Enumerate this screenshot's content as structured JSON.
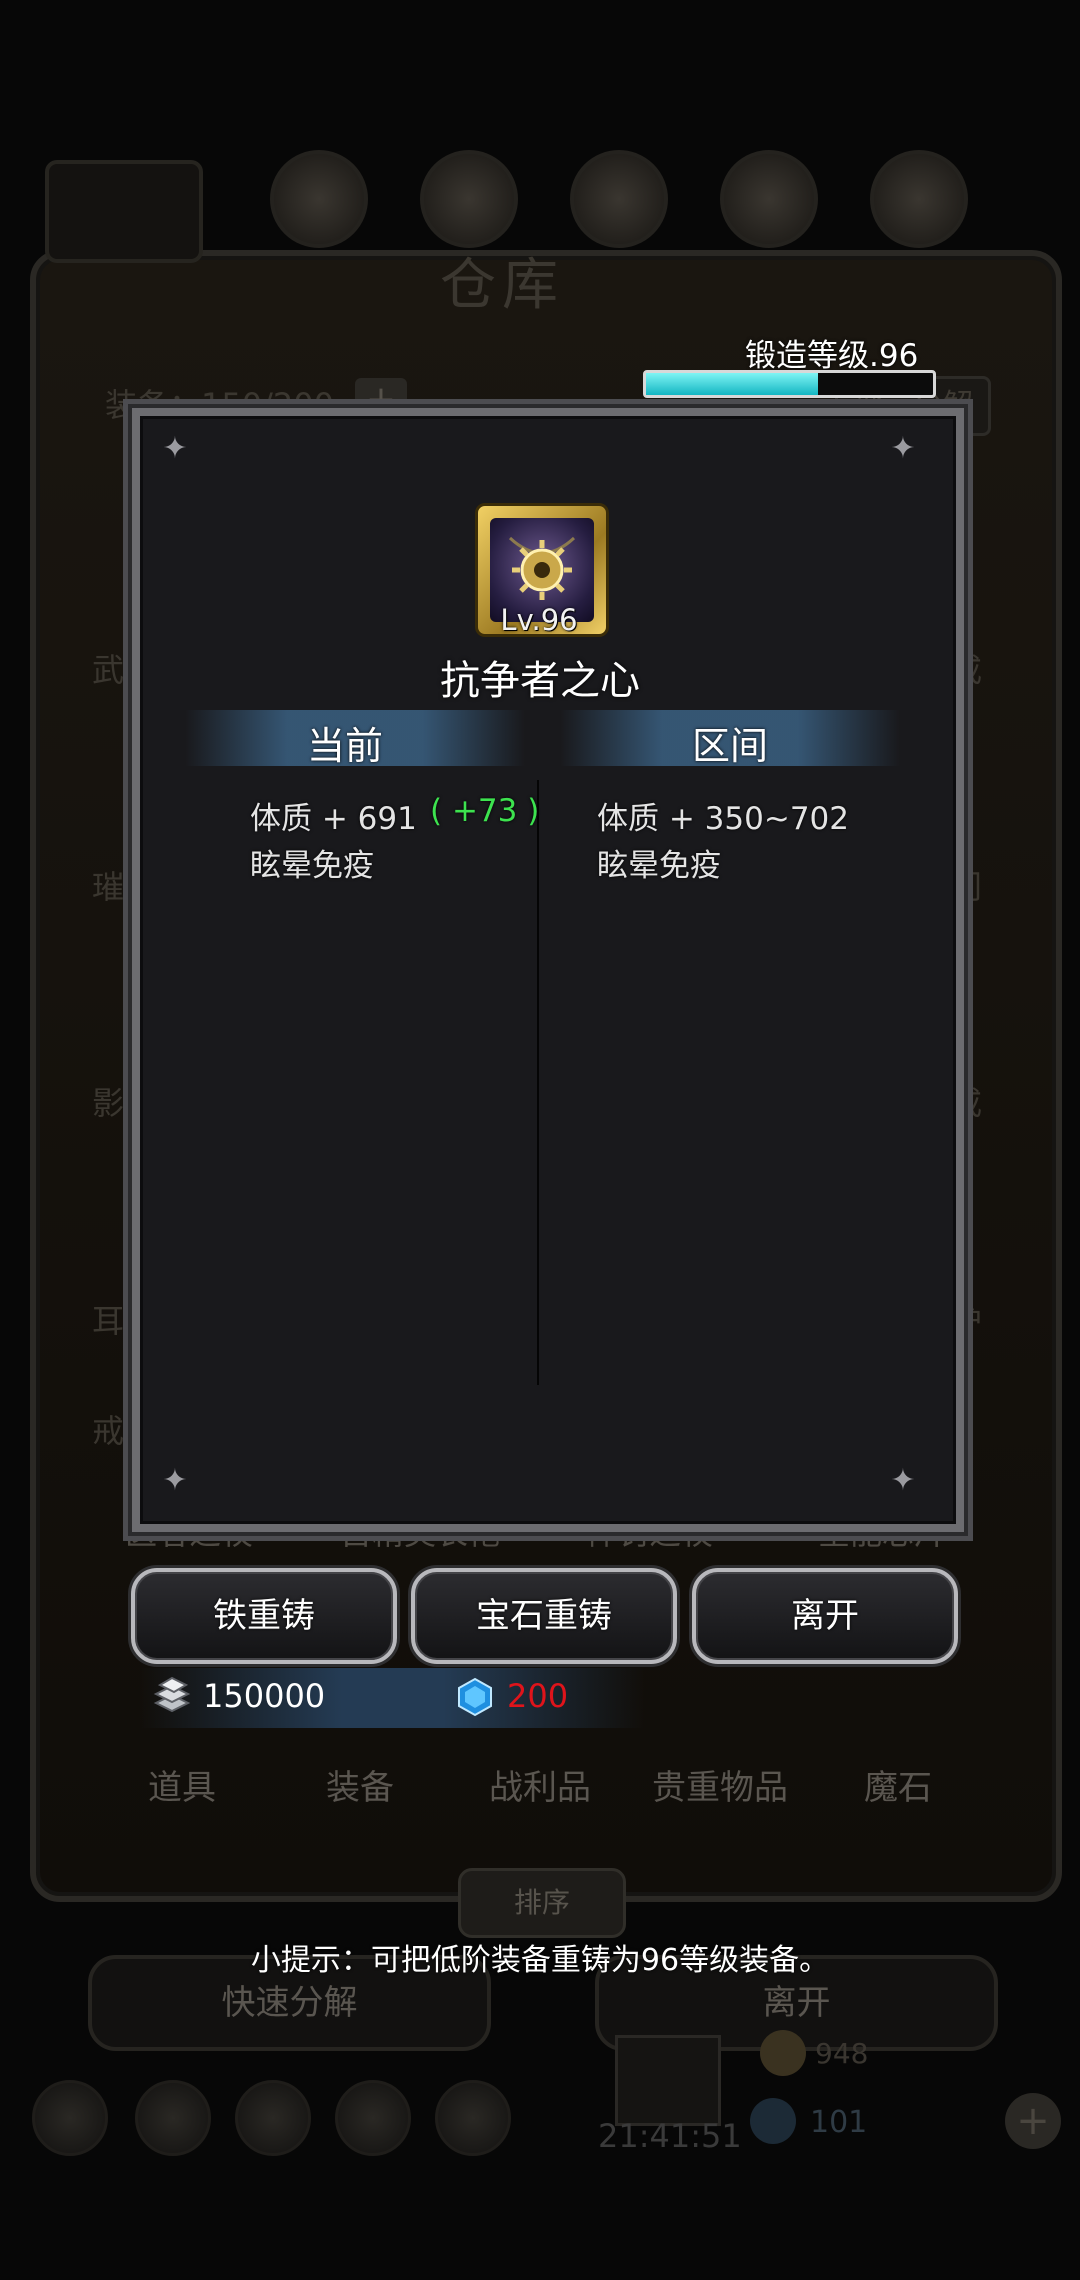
{
  "background": {
    "title": "仓库",
    "equip_count": "装备：150/200",
    "plus": "+",
    "batch_decompose": "批量分解",
    "side_labels_left": [
      "武器",
      "璀璨",
      "影",
      "耳",
      "戒"
    ],
    "side_labels_right": [
      "戒",
      "门",
      "戒",
      "护"
    ],
    "item_names": [
      "医者之杖",
      "古精灵长袍",
      "神罚之杖",
      "全能芯片"
    ],
    "tabs": [
      "道具",
      "装备",
      "战利品",
      "贵重物品",
      "魔石"
    ],
    "sort_button": "排序",
    "quick_decompose": "快速分解",
    "leave_bottom": "离开",
    "clock": "21:41:51",
    "num_1": "948",
    "num_2": "101"
  },
  "forge": {
    "label": "锻造等级.96",
    "progress": 0.6
  },
  "dialog": {
    "item_level": "Lv.96",
    "item_name": "抗争者之心",
    "current_header": "当前",
    "range_header": "区间",
    "current_stats": {
      "stat1": "体质 + 691",
      "stat1_bonus": "( +73 )",
      "stat2": "眩晕免疫"
    },
    "range_stats": {
      "stat1": "体质 + 350~702",
      "stat2": "眩晕免疫"
    }
  },
  "actions": {
    "iron_reforge": "铁重铸",
    "gem_reforge": "宝石重铸",
    "leave": "离开"
  },
  "currency": {
    "silver_icon": "silver-ingot-icon",
    "silver": "150000",
    "gem_icon": "blue-gem-icon",
    "gem": "200",
    "gem_color": "#e0141b"
  },
  "tip": "小提示：可把低阶装备重铸为96等级装备。"
}
